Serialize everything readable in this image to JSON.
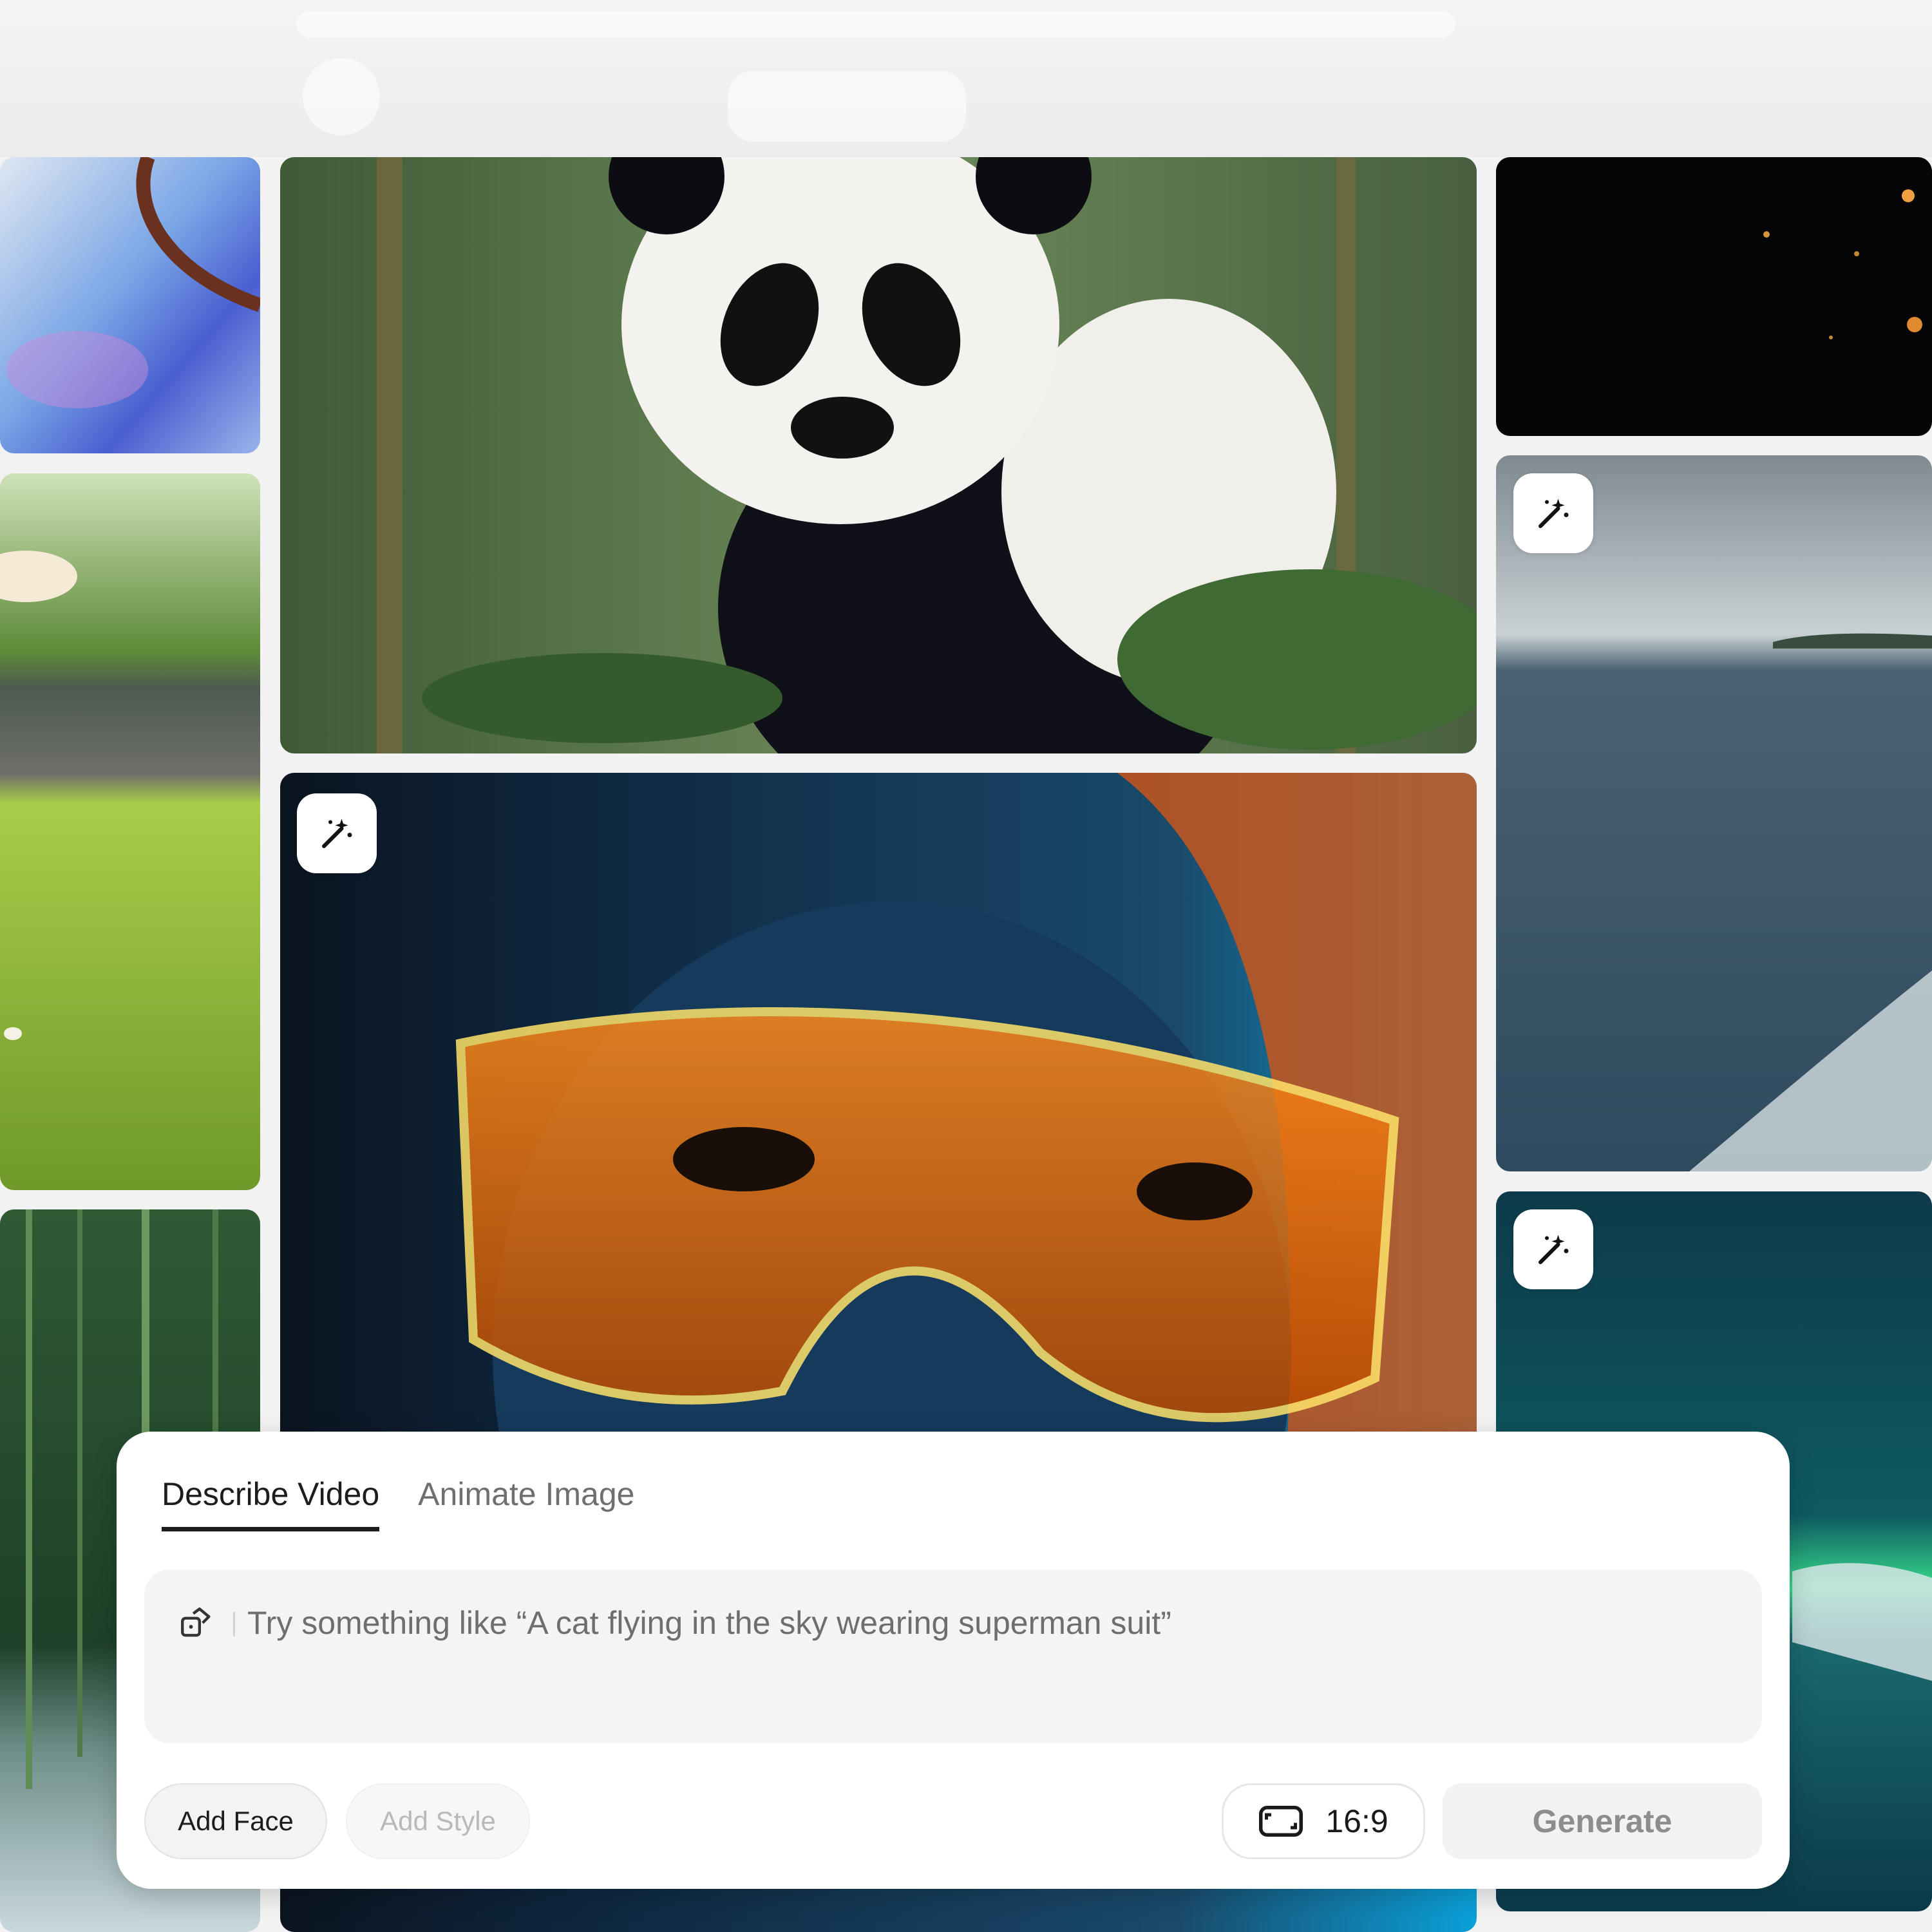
{
  "composer": {
    "tabs": [
      {
        "label": "Describe Video",
        "active": true
      },
      {
        "label": "Animate Image",
        "active": false
      }
    ],
    "prompt": {
      "placeholder": "Try something like “A cat flying in the sky wearing superman suit”",
      "value": ""
    },
    "add_face_label": "Add Face",
    "add_style_label": "Add Style",
    "aspect_ratio": "16:9",
    "generate_label": "Generate"
  },
  "gallery": {
    "tiles": [
      {
        "subject": "abstract iridescent swirl"
      },
      {
        "subject": "bird over grass field"
      },
      {
        "subject": "bamboo forest"
      },
      {
        "subject": "giant panda in forest"
      },
      {
        "subject": "woman with glowing goggles",
        "has_badge": true
      },
      {
        "subject": "dark starry sky"
      },
      {
        "subject": "ocean waves coastline",
        "has_badge": true
      },
      {
        "subject": "aurora over sea",
        "has_badge": true
      }
    ]
  },
  "icons": {
    "badge": "magic-wand-icon",
    "prompt": "dice-icon",
    "ratio": "aspect-ratio-icon"
  }
}
